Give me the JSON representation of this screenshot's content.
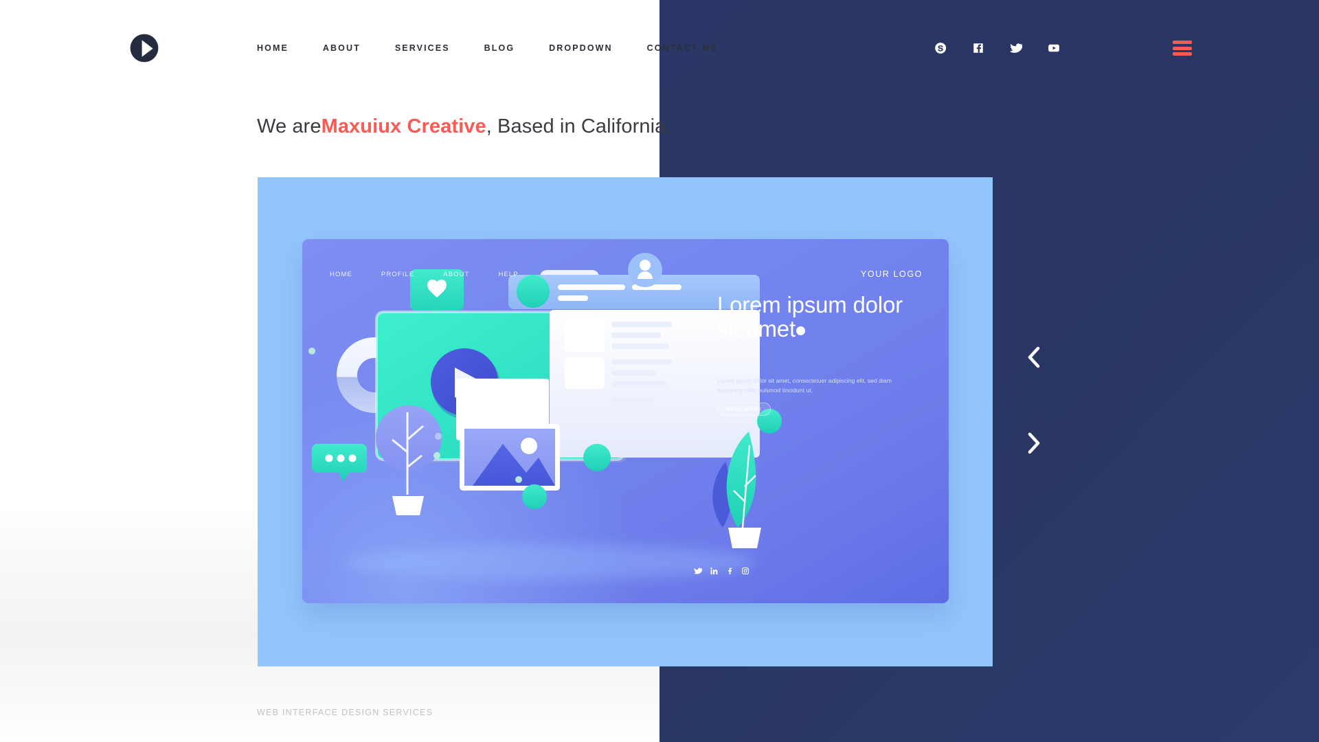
{
  "brand": {
    "logo_icon": "play-circle-logo"
  },
  "header": {
    "nav": [
      {
        "label": "HOME"
      },
      {
        "label": "ABOUT"
      },
      {
        "label": "SERVICES"
      },
      {
        "label": "BLOG"
      },
      {
        "label": "DROPDOWN"
      },
      {
        "label": "CONTACT ME"
      }
    ],
    "social": [
      {
        "icon": "skype-icon",
        "name": "Skype"
      },
      {
        "icon": "facebook-icon",
        "name": "Facebook"
      },
      {
        "icon": "twitter-icon",
        "name": "Twitter"
      },
      {
        "icon": "youtube-icon",
        "name": "YouTube"
      }
    ],
    "menu_toggle_icon": "hamburger-icon"
  },
  "hero": {
    "headline_prefix": "We are",
    "headline_highlight": "Maxuiux Creative",
    "headline_suffix": ", Based in California.",
    "footnote": "WEB INTERFACE DESIGN SERVICES"
  },
  "slider": {
    "prev_icon": "chevron-left-icon",
    "next_icon": "chevron-right-icon"
  },
  "mockup": {
    "nav": [
      {
        "label": "HOME"
      },
      {
        "label": "PROFILE"
      },
      {
        "label": "ABOUT"
      },
      {
        "label": "HELP"
      }
    ],
    "logo_text": "YOUR LOGO",
    "title": "Lorem ipsum dolor sit amet",
    "paragraph": "Lorem ipsum dolor sit amet, consectetuer adipiscing elit, sed diam nonummy nibh euismod tincidunt ut.",
    "cta_label": "READ MORE",
    "social": [
      {
        "icon": "twitter-icon"
      },
      {
        "icon": "linkedin-icon"
      },
      {
        "icon": "facebook-icon"
      },
      {
        "icon": "instagram-icon"
      }
    ]
  },
  "colors": {
    "accent_coral": "#fb5a55",
    "navy_panel": "#2a3766",
    "light_blue_panel": "#93c5fd",
    "mockup_violet": "#7385ef",
    "mint": "#2fe0c2",
    "text_dark": "#2e2e38",
    "text_muted": "#c2c2c6"
  }
}
